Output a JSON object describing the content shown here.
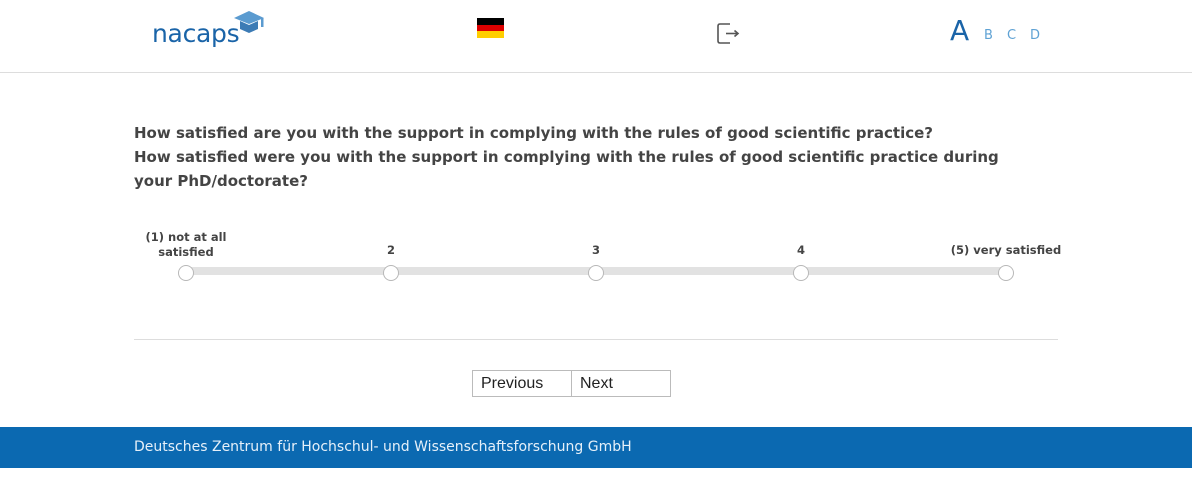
{
  "header": {
    "logo_text": "nacaps",
    "language_flag_icon": "flag-germany-icon",
    "flag_colors": [
      "#000000",
      "#dd0000",
      "#ffce00"
    ],
    "logout_icon": "logout-icon",
    "font_sizes": [
      "A",
      "B",
      "C",
      "D"
    ]
  },
  "question": {
    "line1": "How satisfied are you with the support in complying with the rules of good scientific practice?",
    "line2": "How satisfied were you with the support in complying with the rules of good scientific practice during your PhD/doctorate?"
  },
  "scale": {
    "options": [
      {
        "label": "(1) not at all satisfied",
        "selected": false
      },
      {
        "label": "2",
        "selected": false
      },
      {
        "label": "3",
        "selected": false
      },
      {
        "label": "4",
        "selected": false
      },
      {
        "label": "(5) very satisfied",
        "selected": false
      }
    ]
  },
  "nav": {
    "previous_label": "Previous",
    "next_label": "Next"
  },
  "footer": {
    "text": "Deutsches Zentrum für Hochschul- und Wissenschaftsforschung GmbH"
  },
  "colors": {
    "brand": "#1a64a8",
    "footer_bg": "#0b69b1"
  }
}
